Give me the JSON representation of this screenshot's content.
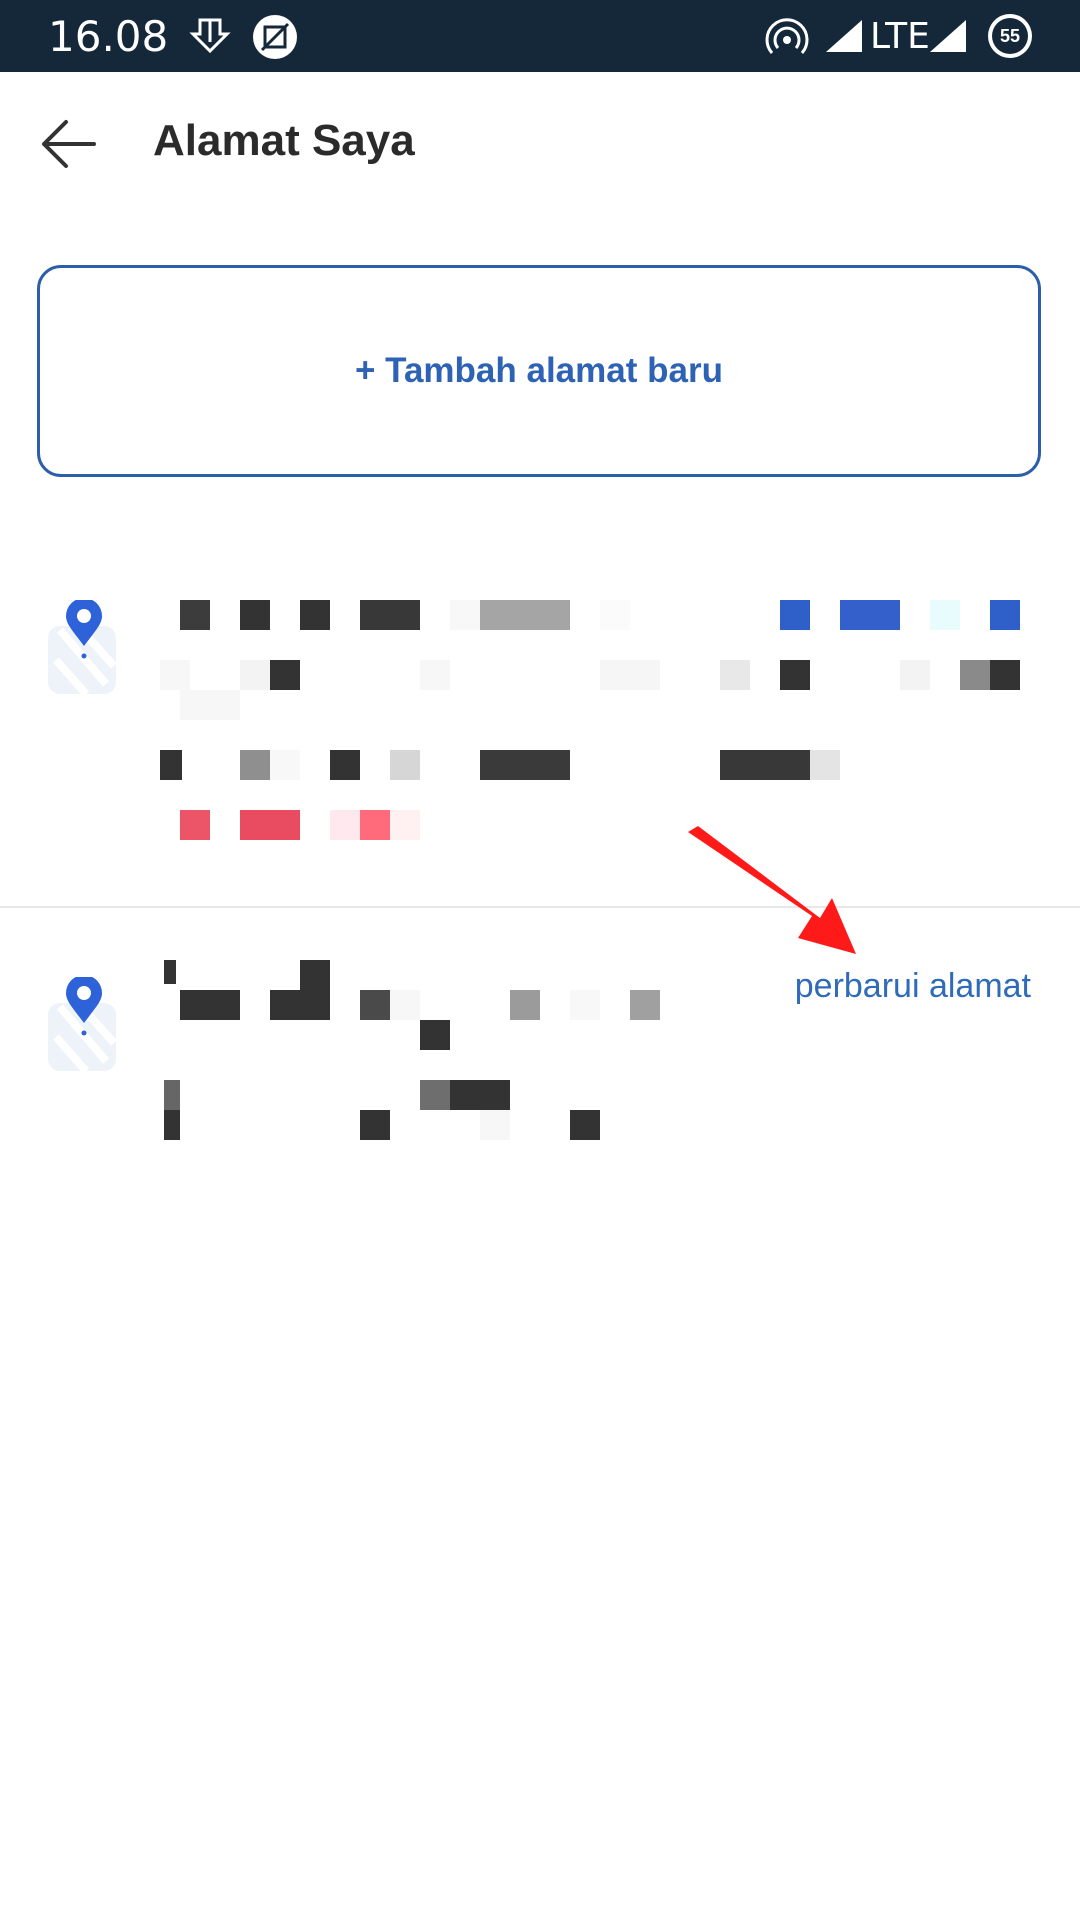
{
  "status_bar": {
    "time": "16.08",
    "network": "LTE",
    "battery": "55"
  },
  "header": {
    "title": "Alamat Saya"
  },
  "add_address": {
    "label": "+ Tambah alamat baru"
  },
  "addresses": [
    {
      "redacted": true
    },
    {
      "redacted": true,
      "action_label": "perbarui alamat"
    }
  ],
  "colors": {
    "status_bar_bg": "#15283a",
    "accent": "#2e62b4",
    "annotation": "#ff1a1a"
  }
}
